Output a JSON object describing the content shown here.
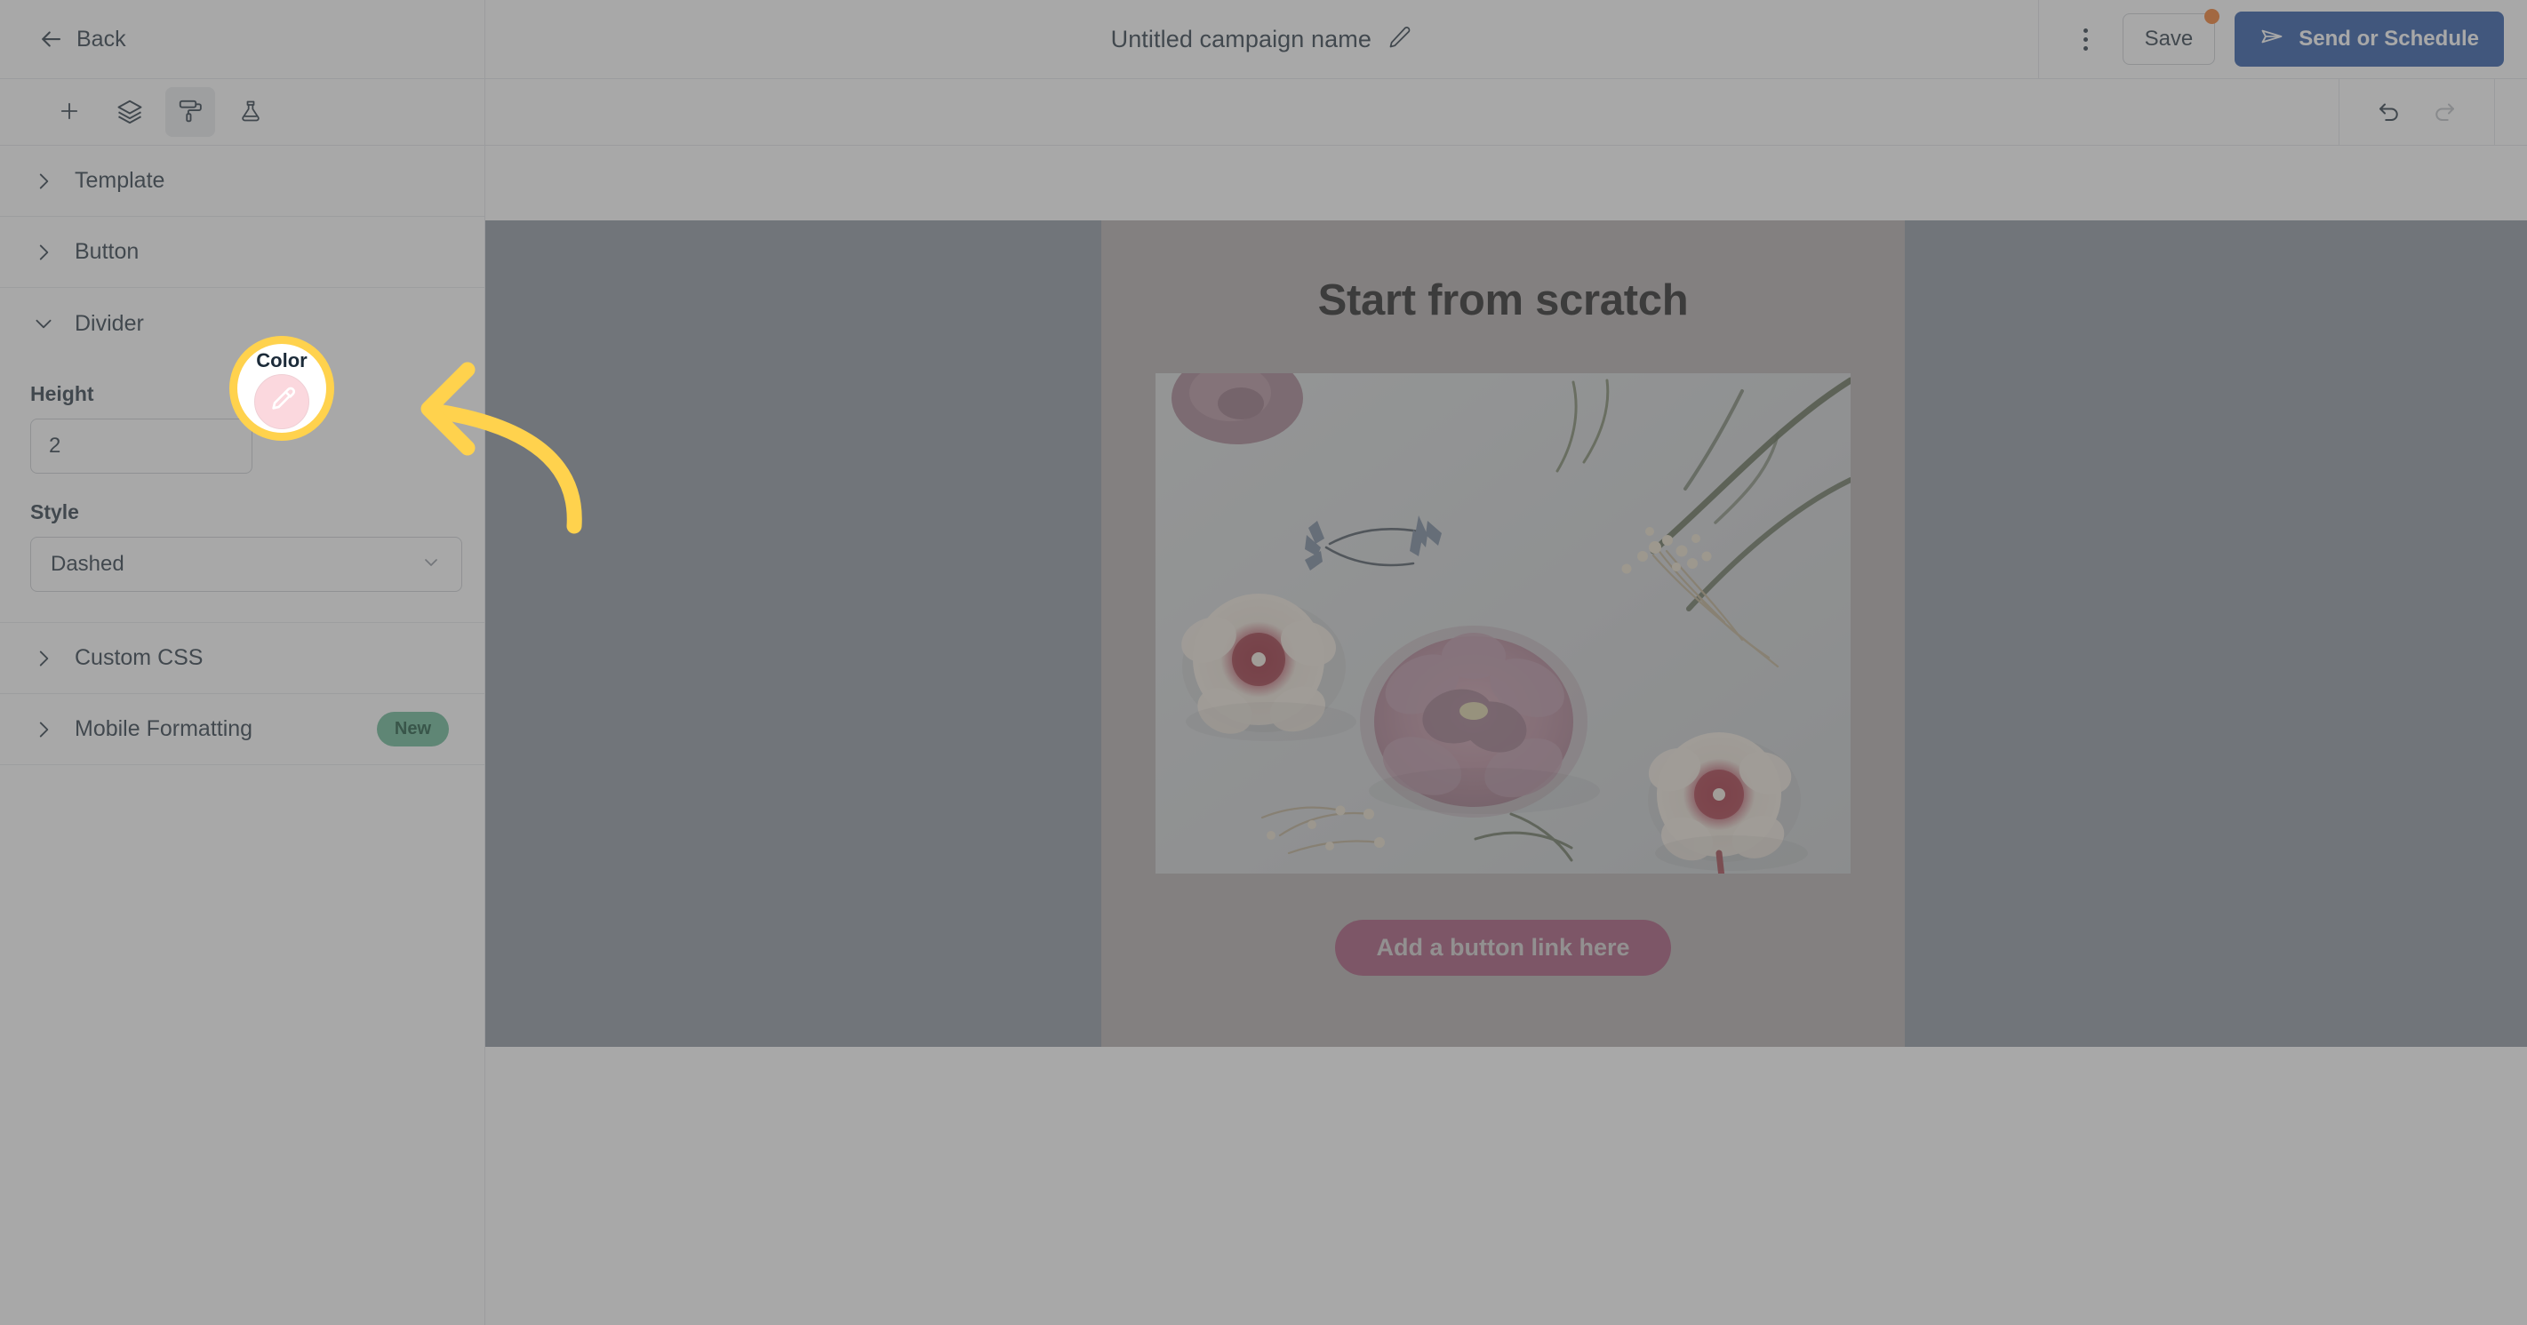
{
  "header": {
    "back_label": "Back",
    "back_icon": "arrow-left-icon",
    "campaign_title": "Untitled campaign name",
    "edit_icon": "pencil-icon",
    "kebab_icon": "more-vertical-icon",
    "save_label": "Save",
    "save_has_unsaved_badge": true,
    "send_label": "Send or Schedule",
    "send_icon": "paper-plane-icon"
  },
  "sidebar": {
    "tools": [
      {
        "name": "add-block-tool",
        "icon": "plus-icon",
        "active": false
      },
      {
        "name": "layers-tool",
        "icon": "layers-icon",
        "active": false
      },
      {
        "name": "styles-tool",
        "icon": "paint-roller-icon",
        "active": true
      },
      {
        "name": "experiments-tool",
        "icon": "flask-icon",
        "active": false
      }
    ],
    "sections": [
      {
        "label": "Template",
        "expanded": false,
        "chevron": "chevron-right-icon",
        "badge": null
      },
      {
        "label": "Button",
        "expanded": false,
        "chevron": "chevron-right-icon",
        "badge": null
      },
      {
        "label": "Divider",
        "expanded": true,
        "chevron": "chevron-down-icon",
        "badge": null
      }
    ],
    "sections_after": [
      {
        "label": "Custom CSS",
        "expanded": false,
        "chevron": "chevron-right-icon",
        "badge": null
      },
      {
        "label": "Mobile Formatting",
        "expanded": false,
        "chevron": "chevron-right-icon",
        "badge": "New"
      }
    ],
    "divider_panel": {
      "height_label": "Height",
      "height_value": "2",
      "decrement_label": "−",
      "increment_label": "+",
      "style_label": "Style",
      "style_value": "Dashed",
      "style_chevron": "chevron-down-icon"
    }
  },
  "canvas": {
    "undo_icon": "undo-icon",
    "redo_icon": "redo-icon",
    "email": {
      "heading": "Start from scratch",
      "hero_image_alt": "dried-flowers-flatlay-photo",
      "cta_label": "Add a button link here"
    }
  },
  "annotation": {
    "label": "Color",
    "swatch_icon": "eyedropper-icon",
    "swatch_color": "#fbd8de",
    "ring_color": "#ffd24d",
    "arrow_icon": "curved-arrow-left-icon"
  }
}
